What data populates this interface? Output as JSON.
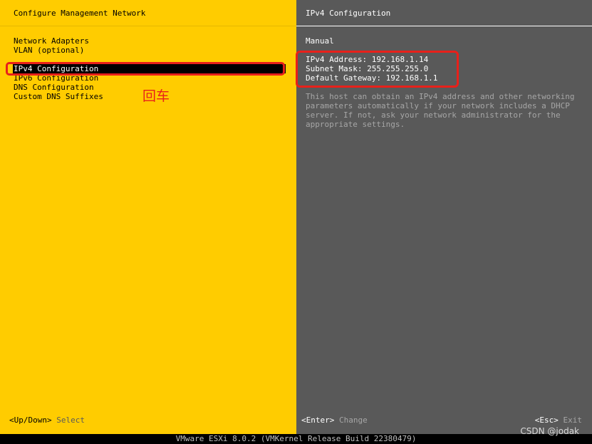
{
  "colors": {
    "left_bg": "#FFCC00",
    "right_bg": "#595959",
    "annotation": "#E8201A",
    "desc_text": "#A6A6A6"
  },
  "left": {
    "title": "Configure Management Network",
    "menu": [
      {
        "label": "Network Adapters"
      },
      {
        "label": "VLAN (optional)"
      },
      {
        "label": "IPv4 Configuration",
        "selected": true
      },
      {
        "label": "IPv6 Configuration"
      },
      {
        "label": "DNS Configuration"
      },
      {
        "label": "Custom DNS Suffixes"
      }
    ]
  },
  "right": {
    "title": "IPv4 Configuration",
    "mode": "Manual",
    "ipv4_address": "IPv4 Address: 192.168.1.14",
    "subnet_mask": "Subnet Mask: 255.255.255.0",
    "default_gateway": "Default Gateway: 192.168.1.1",
    "description": "This host can obtain an IPv4 address and other networking\nparameters automatically if your network includes a DHCP\nserver. If not, ask your network administrator for the\nappropriate settings."
  },
  "footer": {
    "updown_key": "<Up/Down>",
    "updown_action": "Select",
    "enter_key": "<Enter>",
    "enter_action": "Change",
    "esc_key": "<Esc>",
    "esc_action": "Exit"
  },
  "status_bar": "VMware ESXi 8.0.2 (VMKernel Release Build 22380479)",
  "annotation_text": "回车",
  "watermark": "CSDN @jodak"
}
